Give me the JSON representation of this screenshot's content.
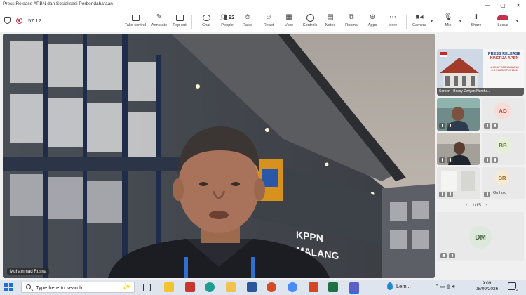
{
  "window": {
    "title": "Press Release APBN dan Sosialisasi Perbendaharaan",
    "controls": [
      "—",
      "▢",
      "✕"
    ]
  },
  "meeting": {
    "timer": "57:12",
    "participant_count": "92",
    "toolbar": [
      {
        "id": "take-control",
        "label": "Take control",
        "icon": "take-control-icon"
      },
      {
        "id": "annotate",
        "label": "Annotate",
        "icon": "annotate-icon"
      },
      {
        "id": "pop-out",
        "label": "Pop out",
        "icon": "pop-out-icon"
      },
      {
        "id": "chat",
        "label": "Chat",
        "icon": "chat-icon"
      },
      {
        "id": "people",
        "label": "People",
        "icon": "people-icon"
      },
      {
        "id": "raise",
        "label": "Raise",
        "icon": "raise-hand-icon"
      },
      {
        "id": "react",
        "label": "React",
        "icon": "react-icon"
      },
      {
        "id": "view",
        "label": "View",
        "icon": "view-icon"
      },
      {
        "id": "controls",
        "label": "Controls",
        "icon": "controls-icon"
      },
      {
        "id": "notes",
        "label": "Notes",
        "icon": "notes-icon"
      },
      {
        "id": "rooms",
        "label": "Rooms",
        "icon": "rooms-icon"
      },
      {
        "id": "apps",
        "label": "Apps",
        "icon": "apps-icon"
      },
      {
        "id": "more",
        "label": "More",
        "icon": "more-icon"
      },
      {
        "id": "camera",
        "label": "Camera",
        "icon": "camera-icon"
      },
      {
        "id": "mic",
        "label": "Mic",
        "icon": "mic-icon"
      },
      {
        "id": "share",
        "label": "Share",
        "icon": "share-icon"
      },
      {
        "id": "leave",
        "label": "Leave",
        "icon": "leave-phone-icon"
      }
    ]
  },
  "main_video": {
    "name": "Muhammad Rusna",
    "sign_text_1": "KPPN",
    "sign_text_2": "MALANG"
  },
  "right_panel": {
    "slide_title_1": "PRESS RELEASE",
    "slide_title_2": "KINERJA APBN",
    "slide_sub_1": "LINGKUP APBN MALANG",
    "slide_sub_2": "S.D 31 AGUSTUS 2026",
    "screen_label": "Screen · Bossy Dwiyan Nursha...",
    "tiles": [
      {
        "initials": "AD",
        "color": "#f7dcd7",
        "text_color": "#b04a3a"
      },
      {
        "initials": "BB",
        "color": "#e6efd9",
        "text_color": "#6a7f3f"
      },
      {
        "initials": "BR",
        "color": "#f5ead5",
        "text_color": "#9b6b1f"
      },
      {
        "initials": "DM",
        "color": "#dde9dd",
        "text_color": "#4b6b4b"
      }
    ],
    "on_hold": "On hold",
    "pager": "1/15"
  },
  "taskbar": {
    "search_placeholder": "Type here to search",
    "weather": "Lem...",
    "time": "9:09",
    "date": "08/09/2026",
    "notification_count": "2"
  },
  "colors": {
    "accent": "#5b5fc7",
    "leave": "#c4314b",
    "taskbar": "#dfe5ee"
  }
}
